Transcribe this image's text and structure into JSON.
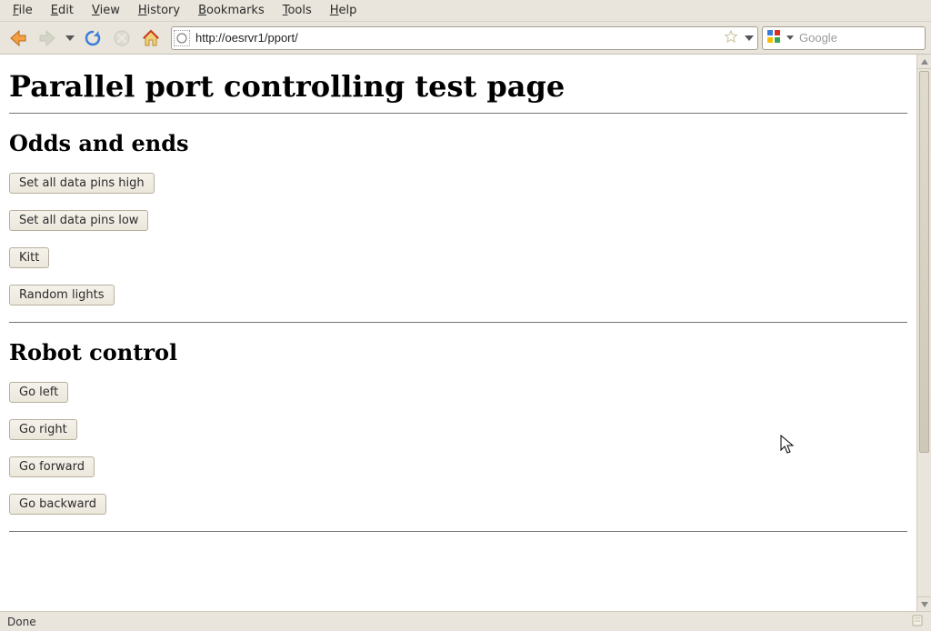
{
  "menubar": {
    "file": "File",
    "edit": "Edit",
    "view": "View",
    "history": "History",
    "bookmarks": "Bookmarks",
    "tools": "Tools",
    "help": "Help"
  },
  "toolbar": {
    "url": "http://oesrvr1/pport/",
    "search_placeholder": "Google"
  },
  "page": {
    "title": "Parallel port controlling test page",
    "section1": {
      "heading": "Odds and ends",
      "btn_all_high": "Set all data pins high",
      "btn_all_low": "Set all data pins low",
      "btn_kitt": "Kitt",
      "btn_random": "Random lights"
    },
    "section2": {
      "heading": "Robot control",
      "btn_left": "Go left",
      "btn_right": "Go right",
      "btn_forward": "Go forward",
      "btn_backward": "Go backward"
    }
  },
  "statusbar": {
    "text": "Done"
  }
}
